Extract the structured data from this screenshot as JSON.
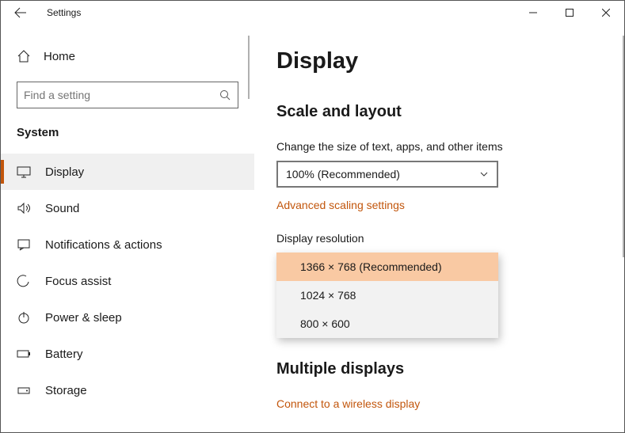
{
  "window": {
    "title": "Settings"
  },
  "sidebar": {
    "home": "Home",
    "search_placeholder": "Find a setting",
    "category": "System",
    "items": [
      {
        "label": "Display",
        "icon": "display-icon",
        "selected": true
      },
      {
        "label": "Sound",
        "icon": "sound-icon",
        "selected": false
      },
      {
        "label": "Notifications & actions",
        "icon": "notifications-icon",
        "selected": false
      },
      {
        "label": "Focus assist",
        "icon": "focus-assist-icon",
        "selected": false
      },
      {
        "label": "Power & sleep",
        "icon": "power-icon",
        "selected": false
      },
      {
        "label": "Battery",
        "icon": "battery-icon",
        "selected": false
      },
      {
        "label": "Storage",
        "icon": "storage-icon",
        "selected": false
      }
    ]
  },
  "main": {
    "title": "Display",
    "scale_section": "Scale and layout",
    "scale_label": "Change the size of text, apps, and other items",
    "scale_value": "100% (Recommended)",
    "advanced_link": "Advanced scaling settings",
    "resolution_label": "Display resolution",
    "resolution_options": [
      {
        "label": "1366 × 768 (Recommended)",
        "selected": true
      },
      {
        "label": "1024 × 768",
        "selected": false
      },
      {
        "label": "800 × 600",
        "selected": false
      }
    ],
    "multiple_section": "Multiple displays",
    "wireless_link": "Connect to a wireless display"
  }
}
